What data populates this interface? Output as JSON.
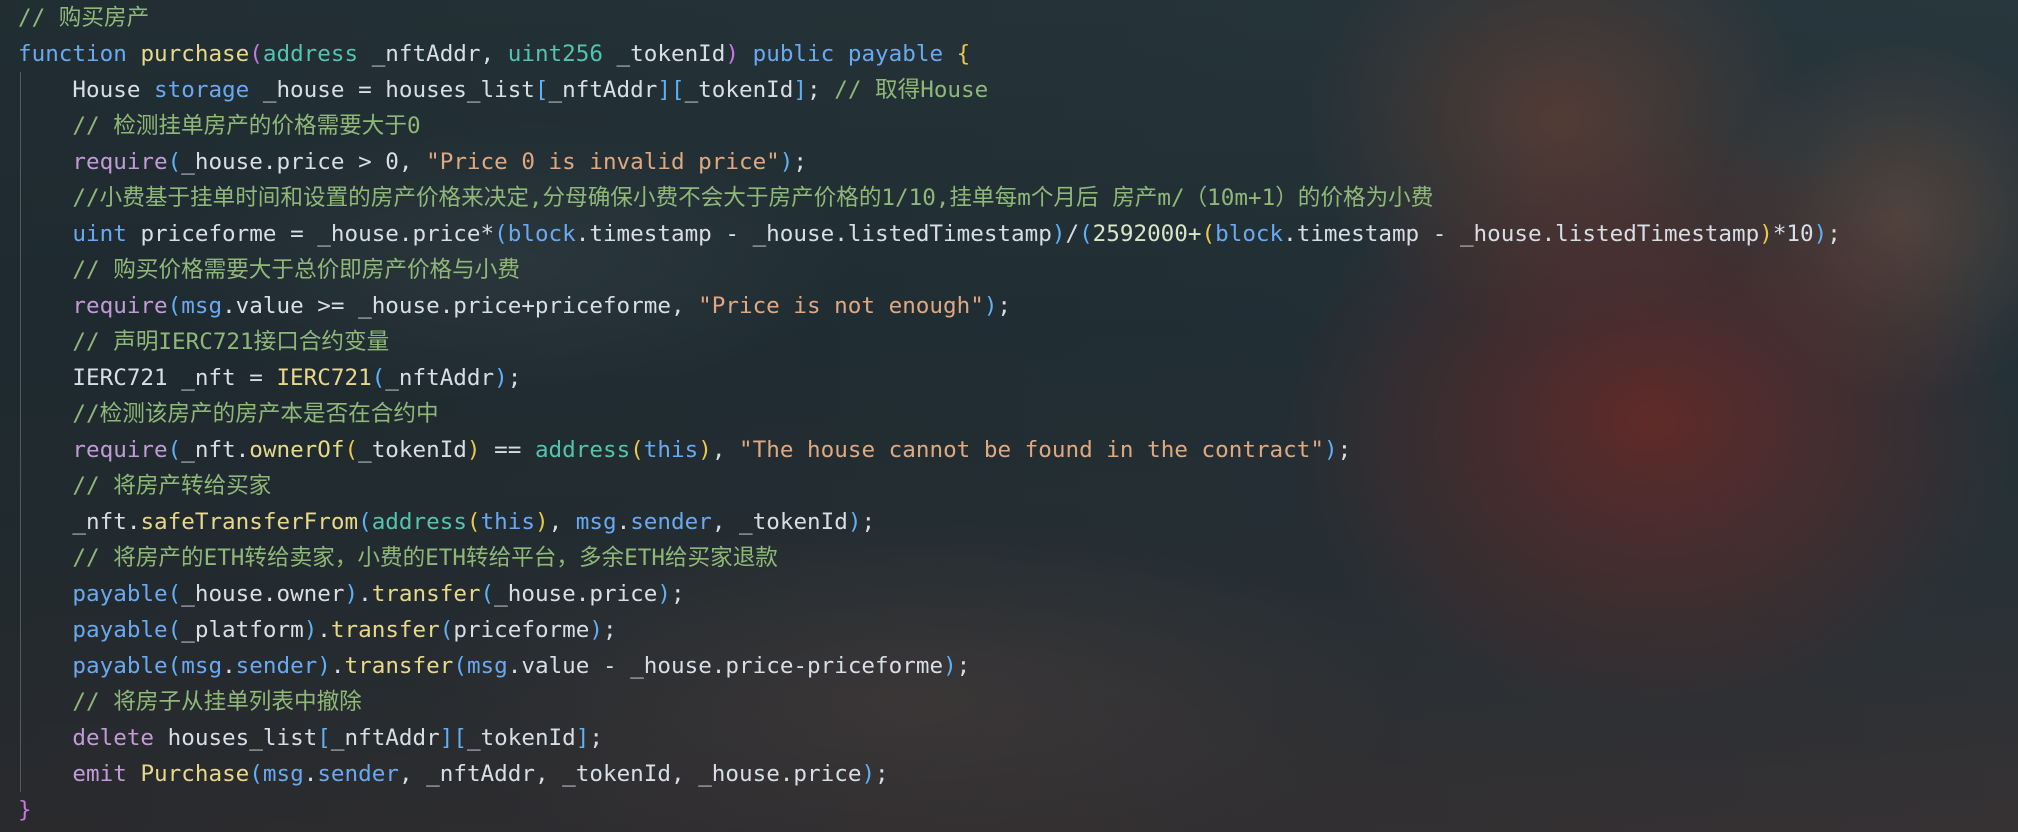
{
  "editor": {
    "lines": [
      {
        "indent": false,
        "tokens": [
          {
            "t": "// 购买房产",
            "c": "comment"
          }
        ]
      },
      {
        "indent": false,
        "tokens": [
          {
            "t": "function",
            "c": "kw"
          },
          {
            "t": " ",
            "c": "var"
          },
          {
            "t": "purchase",
            "c": "fn"
          },
          {
            "t": "(",
            "c": "p2"
          },
          {
            "t": "address",
            "c": "type"
          },
          {
            "t": " _nftAddr, ",
            "c": "var"
          },
          {
            "t": "uint256",
            "c": "type"
          },
          {
            "t": " _tokenId",
            "c": "var"
          },
          {
            "t": ")",
            "c": "p2"
          },
          {
            "t": " ",
            "c": "var"
          },
          {
            "t": "public",
            "c": "kw"
          },
          {
            "t": " ",
            "c": "var"
          },
          {
            "t": "payable",
            "c": "kw"
          },
          {
            "t": " ",
            "c": "var"
          },
          {
            "t": "{",
            "c": "p1"
          }
        ]
      },
      {
        "indent": true,
        "tokens": [
          {
            "t": "    House ",
            "c": "var"
          },
          {
            "t": "storage",
            "c": "kw"
          },
          {
            "t": " _house = houses_list",
            "c": "var"
          },
          {
            "t": "[",
            "c": "p3"
          },
          {
            "t": "_nftAddr",
            "c": "var"
          },
          {
            "t": "]",
            "c": "p3"
          },
          {
            "t": "[",
            "c": "p3"
          },
          {
            "t": "_tokenId",
            "c": "var"
          },
          {
            "t": "]",
            "c": "p3"
          },
          {
            "t": "; ",
            "c": "var"
          },
          {
            "t": "// 取得House",
            "c": "comment"
          }
        ]
      },
      {
        "indent": true,
        "tokens": [
          {
            "t": "    ",
            "c": "var"
          },
          {
            "t": "// 检测挂单房产的价格需要大于0",
            "c": "comment"
          }
        ]
      },
      {
        "indent": true,
        "tokens": [
          {
            "t": "    ",
            "c": "var"
          },
          {
            "t": "require",
            "c": "kw2"
          },
          {
            "t": "(",
            "c": "p3"
          },
          {
            "t": "_house.price > 0, ",
            "c": "var"
          },
          {
            "t": "\"Price 0 is invalid price\"",
            "c": "str"
          },
          {
            "t": ")",
            "c": "p3"
          },
          {
            "t": ";",
            "c": "var"
          }
        ]
      },
      {
        "indent": true,
        "tokens": [
          {
            "t": "    ",
            "c": "var"
          },
          {
            "t": "//小费基于挂单时间和设置的房产价格来决定,分母确保小费不会大于房产价格的1/10,挂单每m个月后 房产m/（10m+1）的价格为小费",
            "c": "comment"
          }
        ]
      },
      {
        "indent": true,
        "tokens": [
          {
            "t": "    ",
            "c": "var"
          },
          {
            "t": "uint",
            "c": "kw"
          },
          {
            "t": " priceforme = _house.price*",
            "c": "var"
          },
          {
            "t": "(",
            "c": "p3"
          },
          {
            "t": "block",
            "c": "kw"
          },
          {
            "t": ".timestamp - _house.listedTimestamp",
            "c": "var"
          },
          {
            "t": ")",
            "c": "p3"
          },
          {
            "t": "/",
            "c": "var"
          },
          {
            "t": "(",
            "c": "p3"
          },
          {
            "t": "2592000+",
            "c": "num"
          },
          {
            "t": "(",
            "c": "p1"
          },
          {
            "t": "block",
            "c": "kw"
          },
          {
            "t": ".timestamp - _house.listedTimestamp",
            "c": "var"
          },
          {
            "t": ")",
            "c": "p1"
          },
          {
            "t": "*10",
            "c": "var"
          },
          {
            "t": ")",
            "c": "p3"
          },
          {
            "t": ";",
            "c": "var"
          }
        ]
      },
      {
        "indent": true,
        "tokens": [
          {
            "t": "    ",
            "c": "var"
          },
          {
            "t": "// 购买价格需要大于总价即房产价格与小费",
            "c": "comment"
          }
        ]
      },
      {
        "indent": true,
        "tokens": [
          {
            "t": "    ",
            "c": "var"
          },
          {
            "t": "require",
            "c": "kw2"
          },
          {
            "t": "(",
            "c": "p3"
          },
          {
            "t": "msg",
            "c": "kw"
          },
          {
            "t": ".value >= _house.price+priceforme, ",
            "c": "var"
          },
          {
            "t": "\"Price is not enough\"",
            "c": "str"
          },
          {
            "t": ")",
            "c": "p3"
          },
          {
            "t": ";",
            "c": "var"
          }
        ]
      },
      {
        "indent": true,
        "tokens": [
          {
            "t": "    ",
            "c": "var"
          },
          {
            "t": "// 声明IERC721接口合约变量",
            "c": "comment"
          }
        ]
      },
      {
        "indent": true,
        "tokens": [
          {
            "t": "    IERC721 _nft = ",
            "c": "var"
          },
          {
            "t": "IERC721",
            "c": "fn"
          },
          {
            "t": "(",
            "c": "p3"
          },
          {
            "t": "_nftAddr",
            "c": "var"
          },
          {
            "t": ")",
            "c": "p3"
          },
          {
            "t": ";",
            "c": "var"
          }
        ]
      },
      {
        "indent": true,
        "tokens": [
          {
            "t": "    ",
            "c": "var"
          },
          {
            "t": "//检测该房产的房产本是否在合约中",
            "c": "comment"
          }
        ]
      },
      {
        "indent": true,
        "tokens": [
          {
            "t": "    ",
            "c": "var"
          },
          {
            "t": "require",
            "c": "kw2"
          },
          {
            "t": "(",
            "c": "p3"
          },
          {
            "t": "_nft.",
            "c": "var"
          },
          {
            "t": "ownerOf",
            "c": "fn"
          },
          {
            "t": "(",
            "c": "p1"
          },
          {
            "t": "_tokenId",
            "c": "var"
          },
          {
            "t": ")",
            "c": "p1"
          },
          {
            "t": " == ",
            "c": "var"
          },
          {
            "t": "address",
            "c": "type"
          },
          {
            "t": "(",
            "c": "p1"
          },
          {
            "t": "this",
            "c": "kw"
          },
          {
            "t": ")",
            "c": "p1"
          },
          {
            "t": ", ",
            "c": "var"
          },
          {
            "t": "\"The house cannot be found in the contract\"",
            "c": "str"
          },
          {
            "t": ")",
            "c": "p3"
          },
          {
            "t": ";",
            "c": "var"
          }
        ]
      },
      {
        "indent": true,
        "tokens": [
          {
            "t": "    ",
            "c": "var"
          },
          {
            "t": "// 将房产转给买家",
            "c": "comment"
          }
        ]
      },
      {
        "indent": true,
        "tokens": [
          {
            "t": "    _nft.",
            "c": "var"
          },
          {
            "t": "safeTransferFrom",
            "c": "fn"
          },
          {
            "t": "(",
            "c": "p3"
          },
          {
            "t": "address",
            "c": "type"
          },
          {
            "t": "(",
            "c": "p1"
          },
          {
            "t": "this",
            "c": "kw"
          },
          {
            "t": ")",
            "c": "p1"
          },
          {
            "t": ", ",
            "c": "var"
          },
          {
            "t": "msg",
            "c": "kw"
          },
          {
            "t": ".",
            "c": "var"
          },
          {
            "t": "sender",
            "c": "kw"
          },
          {
            "t": ", _tokenId",
            "c": "var"
          },
          {
            "t": ")",
            "c": "p3"
          },
          {
            "t": ";",
            "c": "var"
          }
        ]
      },
      {
        "indent": true,
        "tokens": [
          {
            "t": "    ",
            "c": "var"
          },
          {
            "t": "// 将房产的ETH转给卖家，小费的ETH转给平台，多余ETH给买家退款",
            "c": "comment"
          }
        ]
      },
      {
        "indent": true,
        "tokens": [
          {
            "t": "    ",
            "c": "var"
          },
          {
            "t": "payable",
            "c": "kw"
          },
          {
            "t": "(",
            "c": "p3"
          },
          {
            "t": "_house.owner",
            "c": "var"
          },
          {
            "t": ")",
            "c": "p3"
          },
          {
            "t": ".",
            "c": "var"
          },
          {
            "t": "transfer",
            "c": "fn"
          },
          {
            "t": "(",
            "c": "p3"
          },
          {
            "t": "_house.price",
            "c": "var"
          },
          {
            "t": ")",
            "c": "p3"
          },
          {
            "t": ";",
            "c": "var"
          }
        ]
      },
      {
        "indent": true,
        "tokens": [
          {
            "t": "    ",
            "c": "var"
          },
          {
            "t": "payable",
            "c": "kw"
          },
          {
            "t": "(",
            "c": "p3"
          },
          {
            "t": "_platform",
            "c": "var"
          },
          {
            "t": ")",
            "c": "p3"
          },
          {
            "t": ".",
            "c": "var"
          },
          {
            "t": "transfer",
            "c": "fn"
          },
          {
            "t": "(",
            "c": "p3"
          },
          {
            "t": "priceforme",
            "c": "var"
          },
          {
            "t": ")",
            "c": "p3"
          },
          {
            "t": ";",
            "c": "var"
          }
        ]
      },
      {
        "indent": true,
        "tokens": [
          {
            "t": "    ",
            "c": "var"
          },
          {
            "t": "payable",
            "c": "kw"
          },
          {
            "t": "(",
            "c": "p3"
          },
          {
            "t": "msg",
            "c": "kw"
          },
          {
            "t": ".",
            "c": "var"
          },
          {
            "t": "sender",
            "c": "kw"
          },
          {
            "t": ")",
            "c": "p3"
          },
          {
            "t": ".",
            "c": "var"
          },
          {
            "t": "transfer",
            "c": "fn"
          },
          {
            "t": "(",
            "c": "p3"
          },
          {
            "t": "msg",
            "c": "kw"
          },
          {
            "t": ".value - _house.price-priceforme",
            "c": "var"
          },
          {
            "t": ")",
            "c": "p3"
          },
          {
            "t": ";",
            "c": "var"
          }
        ]
      },
      {
        "indent": true,
        "tokens": [
          {
            "t": "    ",
            "c": "var"
          },
          {
            "t": "// 将房子从挂单列表中撤除",
            "c": "comment"
          }
        ]
      },
      {
        "indent": true,
        "tokens": [
          {
            "t": "    ",
            "c": "var"
          },
          {
            "t": "delete",
            "c": "kw2"
          },
          {
            "t": " houses_list",
            "c": "var"
          },
          {
            "t": "[",
            "c": "p3"
          },
          {
            "t": "_nftAddr",
            "c": "var"
          },
          {
            "t": "]",
            "c": "p3"
          },
          {
            "t": "[",
            "c": "p3"
          },
          {
            "t": "_tokenId",
            "c": "var"
          },
          {
            "t": "]",
            "c": "p3"
          },
          {
            "t": ";",
            "c": "var"
          }
        ]
      },
      {
        "indent": true,
        "tokens": [
          {
            "t": "    ",
            "c": "var"
          },
          {
            "t": "emit",
            "c": "kw2"
          },
          {
            "t": " ",
            "c": "var"
          },
          {
            "t": "Purchase",
            "c": "fn"
          },
          {
            "t": "(",
            "c": "p3"
          },
          {
            "t": "msg",
            "c": "kw"
          },
          {
            "t": ".",
            "c": "var"
          },
          {
            "t": "sender",
            "c": "kw"
          },
          {
            "t": ", _nftAddr, _tokenId, _house.price",
            "c": "var"
          },
          {
            "t": ")",
            "c": "p3"
          },
          {
            "t": ";",
            "c": "var"
          }
        ]
      },
      {
        "indent": false,
        "tokens": [
          {
            "t": "}",
            "c": "brace"
          }
        ]
      }
    ]
  }
}
